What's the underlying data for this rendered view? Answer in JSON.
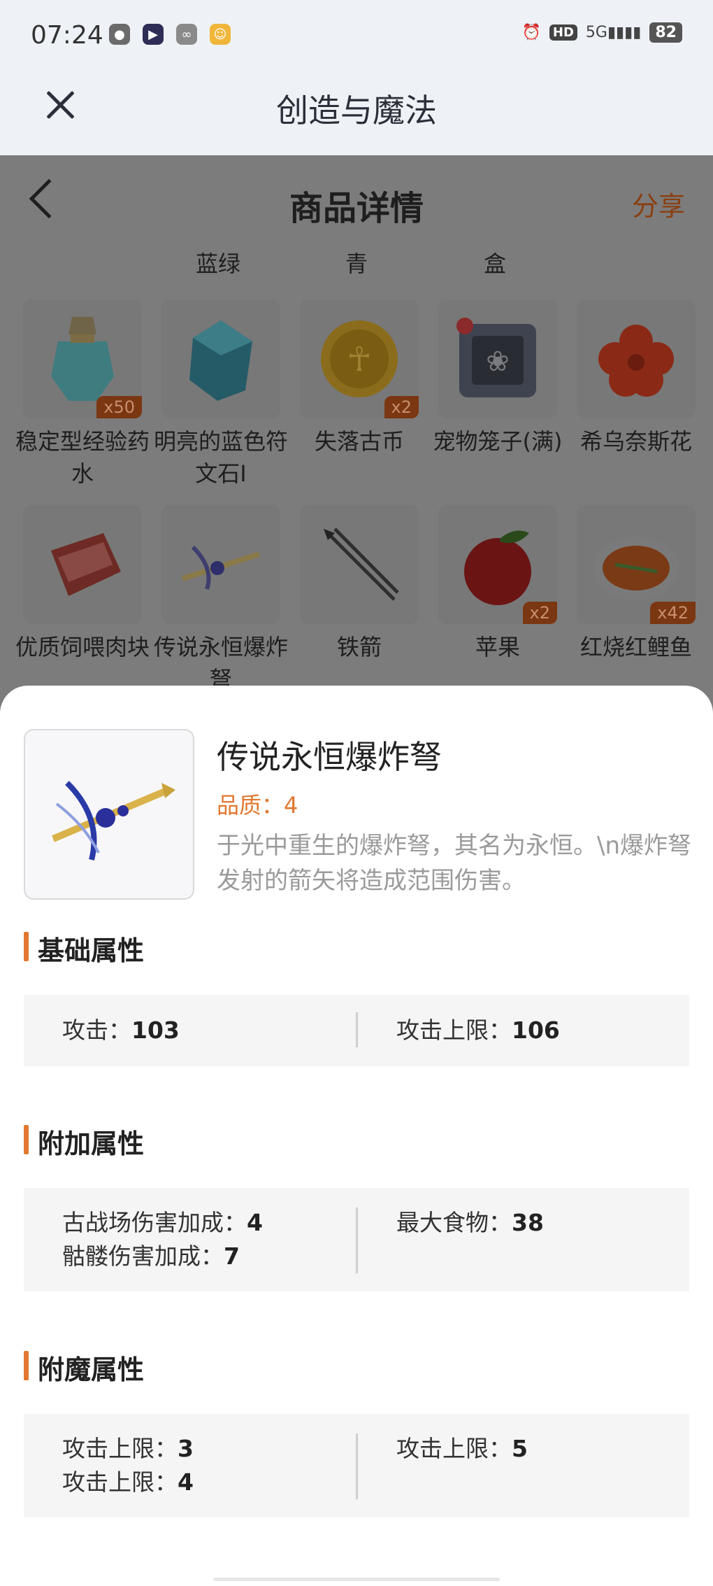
{
  "status": {
    "time": "07:24",
    "network": "5G",
    "hd": "HD",
    "battery": "82"
  },
  "app": {
    "title": "创造与魔法"
  },
  "page": {
    "title": "商品详情",
    "share_label": "分享"
  },
  "filters": [
    "蓝绿",
    "青",
    "盒"
  ],
  "items": [
    {
      "name": "稳定型经验药水",
      "badge": "x50",
      "icon": "potion-icon"
    },
    {
      "name": "明亮的蓝色符文石I",
      "badge": "",
      "icon": "blue-rune-icon"
    },
    {
      "name": "失落古币",
      "badge": "x2",
      "icon": "coin-icon"
    },
    {
      "name": "宠物笼子(满)",
      "badge": "",
      "icon": "pet-cage-icon"
    },
    {
      "name": "希乌奈斯花",
      "badge": "",
      "icon": "flower-icon"
    },
    {
      "name": "优质饲喂肉块",
      "badge": "",
      "icon": "meat-icon"
    },
    {
      "name": "传说永恒爆炸弩",
      "badge": "",
      "icon": "crossbow-icon"
    },
    {
      "name": "铁箭",
      "badge": "",
      "icon": "arrow-icon"
    },
    {
      "name": "苹果",
      "badge": "x2",
      "icon": "apple-icon"
    },
    {
      "name": "红烧红鲤鱼",
      "badge": "x42",
      "icon": "fish-dish-icon"
    }
  ],
  "detail": {
    "name": "传说永恒爆炸弩",
    "quality": "品质：4",
    "description": "于光中重生的爆炸弩，其名为永恒。\\n爆炸弩发射的箭矢将造成范围伤害。",
    "sections": {
      "basic": {
        "title": "基础属性",
        "left": [
          {
            "label": "攻击：",
            "value": "103"
          }
        ],
        "right": [
          {
            "label": "攻击上限：",
            "value": "106"
          }
        ]
      },
      "extra": {
        "title": "附加属性",
        "left": [
          {
            "label": "古战场伤害加成：",
            "value": "4"
          },
          {
            "label": "骷髅伤害加成：",
            "value": "7"
          }
        ],
        "right": [
          {
            "label": "最大食物：",
            "value": "38"
          }
        ]
      },
      "enchant": {
        "title": "附魔属性",
        "left": [
          {
            "label": "攻击上限：",
            "value": "3"
          },
          {
            "label": "攻击上限：",
            "value": "4"
          }
        ],
        "right": [
          {
            "label": "攻击上限：",
            "value": "5"
          }
        ]
      }
    }
  },
  "colors": {
    "accent": "#e0782f",
    "overlay": "#7c7c7c",
    "header": "#eef2f6"
  }
}
